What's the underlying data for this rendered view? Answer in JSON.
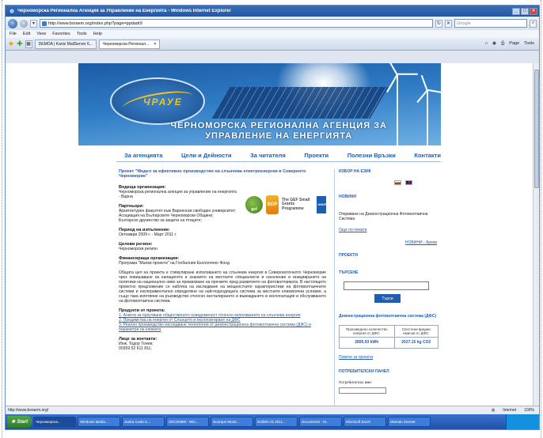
{
  "browser": {
    "window_title": "Черноморска Регионална Агенция за Управление на Енергията - Windows Internet Explorer",
    "url": "http://www.bsraem.org/index.php?page=ppdadr9",
    "search_placeholder": "Google",
    "menu": [
      "File",
      "Edit",
      "View",
      "Favorites",
      "Tools",
      "Help"
    ],
    "tabs": [
      {
        "label": "DEMOA | Kaniz MailServer 6..."
      },
      {
        "label": "Черноморска Регионал..."
      }
    ],
    "tab_tools": [
      "Page",
      "Tools"
    ],
    "status_url": "http://www.bsraem.org/",
    "status_zone": "Internet",
    "zoom": "100%"
  },
  "banner": {
    "logo_text": "ЧРАУЕ",
    "title_line1": "ЧЕРНОМОРСКА РЕГИОНАЛНА АГЕНЦИЯ ЗА",
    "title_line2": "УПРАВЛЕНИЕ НА ЕНЕРГИЯТА"
  },
  "nav": [
    "За агенцията",
    "Цели и Дейности",
    "За читателя",
    "Проекти",
    "Полезни Връзки",
    "Контакти"
  ],
  "article": {
    "project_title": "Проект \"Модел за ефективно производство на слънчева електроенергия в Северното Черноморие\"",
    "lead_org_heading": "Водеща организация:",
    "lead_org": "Черноморска регионална агенция за управление на енергията - Варна",
    "partners_heading": "Партньори:",
    "partners": [
      "Архитектурен факултет към Варненски свободен университет;",
      "Асоциация на Българските Черноморски Общини;",
      "Българско дружество за защита на птиците;"
    ],
    "period_heading": "Период на изпълнение:",
    "period": "Октомври 2009 г. - Март 2011 г.",
    "region_heading": "Целеви регион:",
    "region": "Черноморски регион",
    "funder_heading": "Финансираща организация:",
    "funder": "Програма \"Малки проекти\" на Глобалния Екологичен Фонд",
    "body": "Общата цел на проекта е стимулиране използването на слънчева енергия в Североизточното Черноморие чрез повишаване на капацитета и знанието на местните специалисти и население и инициирането на политики на национално ниво за премахване на пречките пред развитието на фотоволтаиката. В настоящото проектно предложение се набляга на изследване на мощностните характеристики на фотоволтаичните системи и експериментално определяне на най-подходящата система за местните климатични условия, а също така изготвяне на ръководство относно инсталирането и въвеждането в експлоатация и обслужването на фотоволтаична система.",
    "products_heading": "Продукти от проекта:",
    "products": [
      "1. Анкета за проучване общественото осведоменост относно използването на слънчева енергия",
      "2. Предимства на енергия от Слънцето и експлоатиране на ДФС",
      "3. Реално производство изследване технологии от демонстрационна фотоволтаична система (ДФС) и параметри на климата"
    ],
    "contact_heading": "Лице за контакти:",
    "contact_name": "Инж. Тодор Тонев;",
    "contact_phone": "00359 52 611 811;"
  },
  "logos": {
    "gef": "gef",
    "sgp": "SGP",
    "sgp_text": "The GEF Small Grants Programme",
    "undp": "UNDP"
  },
  "sidebar": {
    "lang_heading": "ИЗБОР НА ЕЗИК",
    "news_heading": "НОВИНИ",
    "news_item": "Откриване на Демонстрационна Фотоволтаична Система",
    "news_more": "Още по-темата",
    "news_archive": "НОВИНИ - Архив",
    "projects_heading": "ПРОЕКТИ",
    "search_heading": "ТЪРСЕНЕ",
    "search_button": "Търси",
    "dfs_heading": "Демонстрационна фотоволтаична система (ДФС)",
    "dfs_col1": "Произведено количество енергия от ДФС:",
    "dfs_col2": "Спестени вредни емисии от ДФС:",
    "dfs_val1": "2895.93 kWh",
    "dfs_val2": "2027.15 kg CO2",
    "dfs_more": "Повече за проекта",
    "users_heading": "ПОТРЕБИТЕЛСКИ ПАНЕЛ",
    "username_label": "Потребителско име:"
  },
  "taskbar": {
    "start": "Start",
    "items": [
      "Черноморска...",
      "Windows Media...",
      "avaira ruvdo ic...",
      "DSC00980 - Win...",
      "Bourque Music...",
      "Bulletin 01 2011...",
      "Document2 - M...",
      "Microsoft Excel",
      "Ивелин Златев"
    ]
  }
}
